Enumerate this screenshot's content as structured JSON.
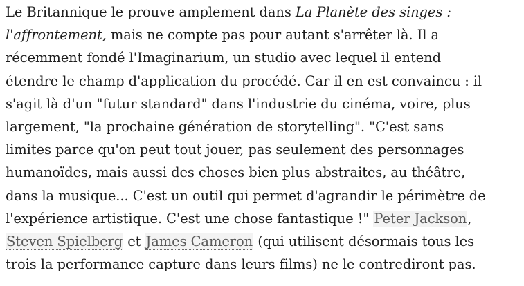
{
  "article": {
    "lines": [
      {
        "pre": "Le Britannique le prouve amplement dans ",
        "em": "La Planète des singes :"
      },
      {
        "em": "l'affrontement,",
        "post": " mais ne compte pas pour autant s'arrêter là. Il a"
      },
      {
        "text": "récemment fondé l'Imaginarium, un studio avec lequel il entend"
      },
      {
        "text": "étendre le champ d'application du procédé. Car il en est convaincu : il"
      },
      {
        "text": "s'agit là d'un \"futur standard\" dans l'industrie du cinéma, voire, plus"
      },
      {
        "text": "largement, \"la prochaine génération de storytelling\". \"C'est sans"
      },
      {
        "text": "limites parce qu'on peut tout jouer, pas seulement des personnages"
      },
      {
        "text": "humanoïdes, mais aussi des choses bien plus abstraites, au théâtre,"
      },
      {
        "text": "dans la musique... C'est un outil qui permet d'agrandir le périmètre de"
      },
      {
        "pre": "l'expérience artistique. C'est une chose fantastique !\" ",
        "link": "Peter Jackson",
        "post": ","
      },
      {
        "link1": "Steven Spielberg",
        "mid": " et ",
        "link2": "James Cameron",
        "post": " (qui utilisent désormais tous les"
      },
      {
        "text": "trois la performance capture dans leurs films) ne le contrediront pas."
      }
    ]
  }
}
